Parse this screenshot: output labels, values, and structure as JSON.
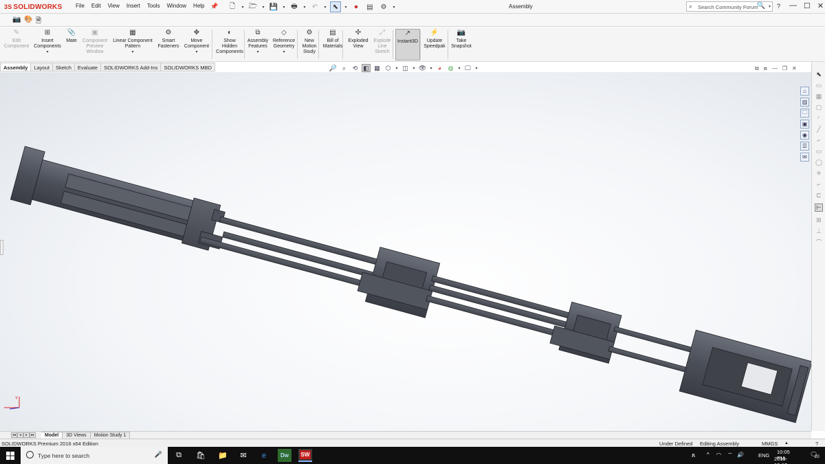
{
  "app": {
    "logo_text": "SOLIDWORKS",
    "logo_mark": "3S",
    "window_title": "Assembly"
  },
  "menus": [
    "File",
    "Edit",
    "View",
    "Insert",
    "Tools",
    "Window",
    "Help"
  ],
  "search": {
    "placeholder": "Search Community Forum"
  },
  "window_controls": {
    "help": "?",
    "minimize": "—",
    "restore": "☐",
    "close": "✕"
  },
  "command_manager": [
    {
      "label": "Edit Component",
      "lines": [
        "Edit",
        "Component"
      ],
      "icon": "edit-component-icon",
      "enabled": false
    },
    {
      "label": "Insert Components",
      "lines": [
        "Insert",
        "Components"
      ],
      "icon": "insert-components-icon",
      "enabled": true,
      "dropdown": true
    },
    {
      "label": "Mate",
      "lines": [
        "Mate"
      ],
      "icon": "mate-icon",
      "enabled": true
    },
    {
      "label": "Component Preview Window",
      "lines": [
        "Component",
        "Preview",
        "Window"
      ],
      "icon": "component-preview-icon",
      "enabled": false
    },
    {
      "label": "Linear Component Pattern",
      "lines": [
        "Linear Component",
        "Pattern"
      ],
      "icon": "linear-pattern-icon",
      "enabled": true,
      "dropdown": true
    },
    {
      "label": "Smart Fasteners",
      "lines": [
        "Smart",
        "Fasteners"
      ],
      "icon": "smart-fasteners-icon",
      "enabled": true
    },
    {
      "label": "Move Component",
      "lines": [
        "Move",
        "Component"
      ],
      "icon": "move-component-icon",
      "enabled": true,
      "dropdown": true
    },
    {
      "label": "Show Hidden Components",
      "lines": [
        "Show",
        "Hidden",
        "Components"
      ],
      "icon": "show-hidden-icon",
      "enabled": true
    },
    {
      "label": "Assembly Features",
      "lines": [
        "Assembly",
        "Features"
      ],
      "icon": "assembly-features-icon",
      "enabled": true,
      "dropdown": true
    },
    {
      "label": "Reference Geometry",
      "lines": [
        "Reference",
        "Geometry"
      ],
      "icon": "reference-geometry-icon",
      "enabled": true,
      "dropdown": true
    },
    {
      "label": "New Motion Study",
      "lines": [
        "New",
        "Motion",
        "Study"
      ],
      "icon": "motion-study-icon",
      "enabled": true
    },
    {
      "label": "Bill of Materials",
      "lines": [
        "Bill of",
        "Materials"
      ],
      "icon": "bom-icon",
      "enabled": true
    },
    {
      "label": "Exploded View",
      "lines": [
        "Exploded",
        "View"
      ],
      "icon": "exploded-view-icon",
      "enabled": true
    },
    {
      "label": "Explode Line Sketch",
      "lines": [
        "Explode",
        "Line",
        "Sketch"
      ],
      "icon": "explode-line-icon",
      "enabled": false
    },
    {
      "label": "Instant3D",
      "lines": [
        "Instant3D"
      ],
      "icon": "instant3d-icon",
      "enabled": true,
      "active": true
    },
    {
      "label": "Update Speedpak",
      "lines": [
        "Update",
        "Speedpak"
      ],
      "icon": "speedpak-icon",
      "enabled": true
    },
    {
      "label": "Take Snapshot",
      "lines": [
        "Take",
        "Snapshot"
      ],
      "icon": "snapshot-icon",
      "enabled": true
    }
  ],
  "cm_tabs": [
    "Assembly",
    "Layout",
    "Sketch",
    "Evaluate",
    "SOLIDWORKS Add-Ins",
    "SOLIDWORKS MBD"
  ],
  "bottom_tabs": [
    "Model",
    "3D Views",
    "Motion Study 1"
  ],
  "status": {
    "edition": "SOLIDWORKS Premium 2016 x64 Edition",
    "defined": "Under Defined",
    "mode": "Editing Assembly",
    "units": "MMGS",
    "units_arrow": "▲"
  },
  "taskbar": {
    "search_placeholder": "Type here to search",
    "lang": "ENG",
    "time": "10:05 PM",
    "date": "2019-10-12",
    "notif_count": "20"
  }
}
